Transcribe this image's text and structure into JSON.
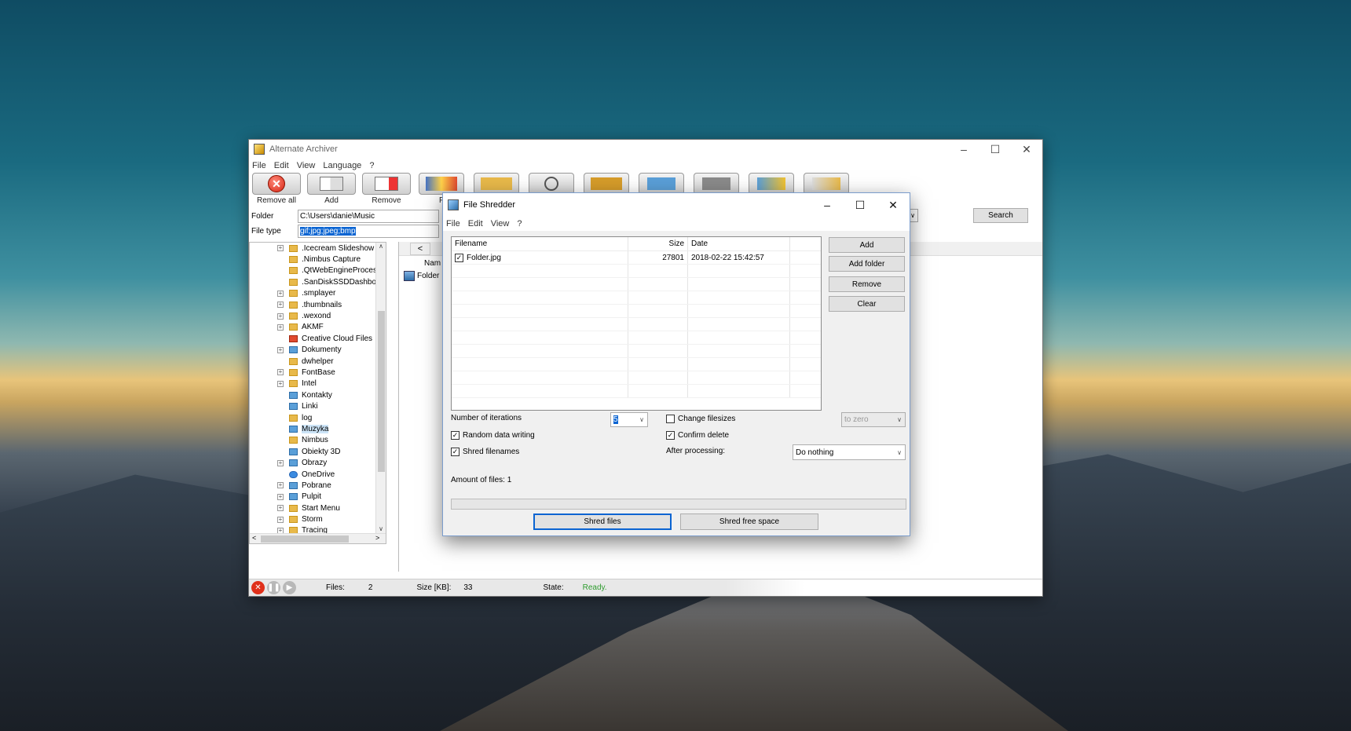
{
  "main_window": {
    "title": "Alternate Archiver",
    "menu": [
      "File",
      "Edit",
      "View",
      "Language",
      "?"
    ],
    "toolbar": {
      "remove_all": "Remove all",
      "add": "Add",
      "remove": "Remove",
      "partial": "F"
    },
    "folder_label": "Folder",
    "folder_value": "C:\\Users\\danie\\Music",
    "filetype_label": "File type",
    "filetype_value": "gif;jpg;jpeg;bmp",
    "search_button": "Search",
    "tree_items": [
      {
        "label": ".Icecream Slideshow I",
        "exp": true
      },
      {
        "label": ".Nimbus Capture",
        "exp": false
      },
      {
        "label": ".QtWebEngineProces",
        "exp": false
      },
      {
        "label": ".SanDiskSSDDashboa",
        "exp": false
      },
      {
        "label": ".smplayer",
        "exp": true
      },
      {
        "label": ".thumbnails",
        "exp": true
      },
      {
        "label": ".wexond",
        "exp": true
      },
      {
        "label": "AKMF",
        "exp": true
      },
      {
        "label": "Creative Cloud Files",
        "exp": false
      },
      {
        "label": "Dokumenty",
        "exp": true
      },
      {
        "label": "dwhelper",
        "exp": false
      },
      {
        "label": "FontBase",
        "exp": true
      },
      {
        "label": "Intel",
        "exp": true
      },
      {
        "label": "Kontakty",
        "exp": false
      },
      {
        "label": "Linki",
        "exp": false
      },
      {
        "label": "log",
        "exp": false
      },
      {
        "label": "Muzyka",
        "exp": false
      },
      {
        "label": "Nimbus",
        "exp": false
      },
      {
        "label": "Obiekty 3D",
        "exp": false
      },
      {
        "label": "Obrazy",
        "exp": true
      },
      {
        "label": "OneDrive",
        "exp": false
      },
      {
        "label": "Pobrane",
        "exp": true
      },
      {
        "label": "Pulpit",
        "exp": true
      },
      {
        "label": "Start Menu",
        "exp": true
      },
      {
        "label": "Storm",
        "exp": true
      },
      {
        "label": "Tracing",
        "exp": true
      }
    ],
    "list_col_name": "Nam",
    "list_item": "Folder",
    "nav_back": "<",
    "status": {
      "files_label": "Files:",
      "files_value": "2",
      "size_label": "Size [KB]:",
      "size_value": "33",
      "state_label": "State:",
      "state_value": "Ready."
    }
  },
  "dialog": {
    "title": "File Shredder",
    "menu": [
      "File",
      "Edit",
      "View",
      "?"
    ],
    "columns": {
      "filename": "Filename",
      "size": "Size",
      "date": "Date"
    },
    "files": [
      {
        "name": "Folder.jpg",
        "size": "27801",
        "date": "2018-02-22 15:42:57",
        "checked": true
      }
    ],
    "buttons": {
      "add": "Add",
      "add_folder": "Add folder",
      "remove": "Remove",
      "clear": "Clear"
    },
    "iterations_label": "Number of iterations",
    "iterations_value": "5",
    "change_filesizes": "Change filesizes",
    "to_zero": "to zero",
    "random_data": "Random data writing",
    "confirm_delete": "Confirm delete",
    "shred_filenames": "Shred filenames",
    "after_processing_label": "After processing:",
    "after_processing_value": "Do nothing",
    "amount_of_files": "Amount of files: 1",
    "shred_files": "Shred files",
    "shred_free_space": "Shred free space"
  },
  "colors": {
    "state_ready": "#2e9c2e",
    "accent_select": "#0a64d2"
  }
}
